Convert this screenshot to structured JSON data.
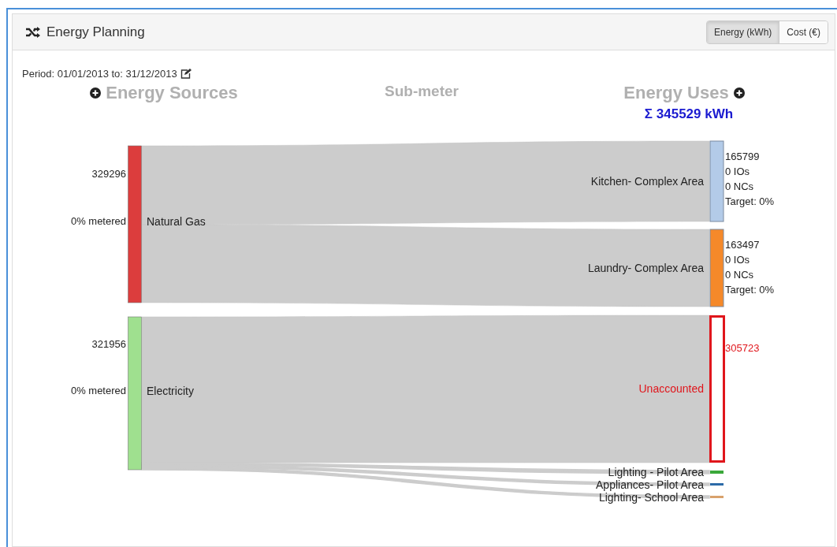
{
  "panel": {
    "title": "Energy Planning",
    "toggle": [
      {
        "label": "Energy (kWh)",
        "selected": true
      },
      {
        "label": "Cost (€)",
        "selected": false
      }
    ]
  },
  "period": "Period: 01/01/2013 to: 31/12/2013",
  "columns": [
    {
      "label": "Energy Sources",
      "kind": "sources"
    },
    {
      "label": "Sub-meter",
      "kind": "meters"
    },
    {
      "label": "Energy Uses",
      "kind": "uses",
      "total": "Σ 345529 kWh"
    }
  ],
  "sankey": {
    "sources": [
      {
        "name": "Natural Gas",
        "value": "329296",
        "metered": "0% metered",
        "color": "#dc3d3d"
      },
      {
        "name": "Electricity",
        "value": "321956",
        "metered": "0% metered",
        "color": "#9fe08f"
      }
    ],
    "uses": [
      {
        "kind": "major",
        "name": "Kitchen- Complex Area",
        "value": "165799",
        "details": [
          "0 IOs",
          "0 NCs",
          "Target: 0%"
        ],
        "color": "#b3cbe8"
      },
      {
        "kind": "major",
        "name": "Laundry- Complex Area",
        "value": "163497",
        "details": [
          "0 IOs",
          "0 NCs",
          "Target: 0%"
        ],
        "color": "#f5892a"
      },
      {
        "kind": "unaccounted",
        "name": "Unaccounted",
        "value": "305723",
        "color": "#e0161c"
      },
      {
        "kind": "minor",
        "name": "Lighting - Pilot Area",
        "color": "#3aa83a"
      },
      {
        "kind": "minor",
        "name": "Appliances- Pilot Area",
        "color": "#2c6aa8"
      },
      {
        "kind": "minor",
        "name": "Lighting- School Area",
        "color": "#d9a26c"
      }
    ]
  }
}
